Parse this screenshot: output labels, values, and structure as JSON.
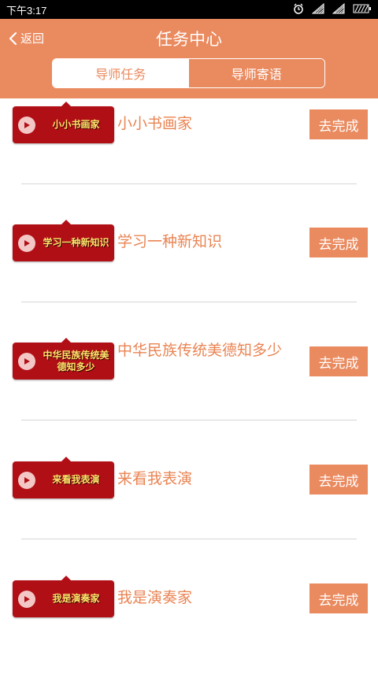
{
  "status_bar": {
    "time": "下午3:17",
    "icons": [
      "alarm-icon",
      "signal-icon",
      "signal-icon-2",
      "battery-icon"
    ]
  },
  "header": {
    "back_label": "返回",
    "title": "任务中心",
    "tabs": [
      {
        "label": "导师任务",
        "active": true
      },
      {
        "label": "导师寄语",
        "active": false
      }
    ]
  },
  "tasks": [
    {
      "thumb_text": "小小书画家",
      "title": "小小书画家",
      "button": "去完成"
    },
    {
      "thumb_text": "学习一种新知识",
      "title": "学习一种新知识",
      "button": "去完成"
    },
    {
      "thumb_text": "中华民族传统美德知多少",
      "title": "中华民族传统美德知多少",
      "button": "去完成"
    },
    {
      "thumb_text": "来看我表演",
      "title": "来看我表演",
      "button": "去完成"
    },
    {
      "thumb_text": "我是演奏家",
      "title": "我是演奏家",
      "button": "去完成"
    }
  ],
  "colors": {
    "accent": "#ea8a5f",
    "thumb_bg": "#b10f16",
    "thumb_text": "#ffe36a",
    "title_text": "#e98453"
  }
}
